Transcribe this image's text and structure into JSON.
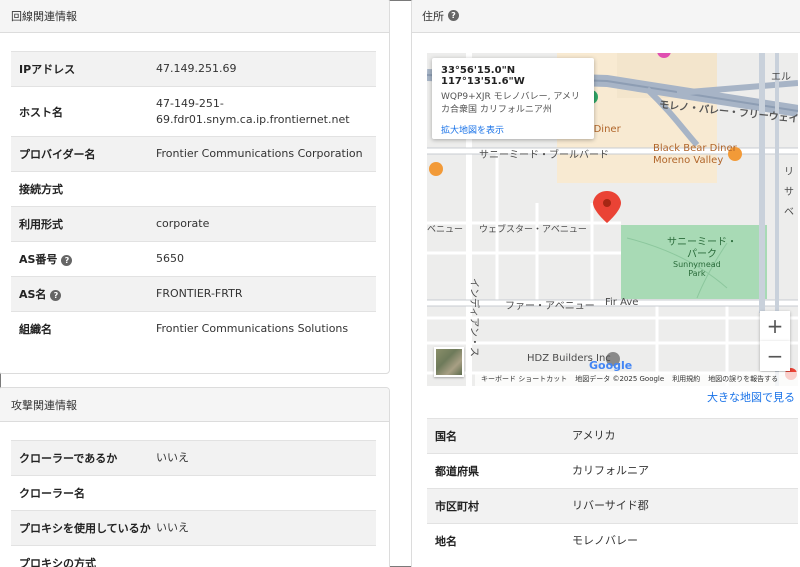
{
  "line_card": {
    "title": "回線関連情報",
    "rows": [
      {
        "key": "IPアドレス",
        "value": "47.149.251.69",
        "help": false
      },
      {
        "key": "ホスト名",
        "value": "47-149-251-\n69.fdr01.snym.ca.ip.frontiernet.net",
        "help": false
      },
      {
        "key": "プロバイダー名",
        "value": "Frontier Communications Corporation",
        "help": false
      },
      {
        "key": "接続方式",
        "value": "",
        "help": false
      },
      {
        "key": "利用形式",
        "value": "corporate",
        "help": false
      },
      {
        "key": "AS番号",
        "value": "5650",
        "help": true
      },
      {
        "key": "AS名",
        "value": "FRONTIER-FRTR",
        "help": true
      },
      {
        "key": "組織名",
        "value": "Frontier Communications Solutions",
        "help": false
      }
    ]
  },
  "attack_card": {
    "title": "攻撃関連情報",
    "rows": [
      {
        "key": "クローラーであるか",
        "value": "いいえ"
      },
      {
        "key": "クローラー名",
        "value": ""
      },
      {
        "key": "プロキシを使用しているか",
        "value": "いいえ"
      },
      {
        "key": "プロキシの方式",
        "value": ""
      }
    ]
  },
  "address_card": {
    "title": "住所",
    "help_icon": "?",
    "map": {
      "coords": "33°56'15.0\"N 117°13'51.6\"W",
      "address": "WQP9+XJR モレノバレー, アメリカ合衆国 カリフォルニア州",
      "view_larger": "拡大地図を表示",
      "labels": {
        "freeway": "モレノ・バレー・フリーウェイ",
        "boulevard": "サニーミード・ブールバード",
        "diner": "Black Bear Diner\nMoreno Valley",
        "dinerL": "on's Diner",
        "park": "サニーミード・\nパーク",
        "park_en": "Sunnymead\nPark",
        "webster": "ウェブスター・アベニュー",
        "venue": "ベニュー",
        "fir": "ファー・アベニュー",
        "fir_en": "Fir Ave",
        "indian": "インディアン・ス",
        "hdz": "HDZ Builders Inc",
        "ri": "リ",
        "el": "エル",
        "sa": "サ",
        "ve": "ベ"
      },
      "zoom_in": "+",
      "zoom_out": "−",
      "google": "Google",
      "footer": [
        "キーボード ショートカット",
        "地図データ ©2025 Google",
        "利用規約",
        "地図の誤りを報告する"
      ]
    },
    "view_larger_map": "大きな地図で見る",
    "rows": [
      {
        "key": "国名",
        "value": "アメリカ"
      },
      {
        "key": "都道府県",
        "value": "カリフォルニア"
      },
      {
        "key": "市区町村",
        "value": "リバーサイド郡"
      },
      {
        "key": "地名",
        "value": "モレノバレー"
      }
    ]
  },
  "colors": {
    "link": "#1a73e8",
    "marker": "#ea4335",
    "park": "#a8dab5",
    "road": "#ffffff",
    "highway": "#a7b4c6"
  }
}
